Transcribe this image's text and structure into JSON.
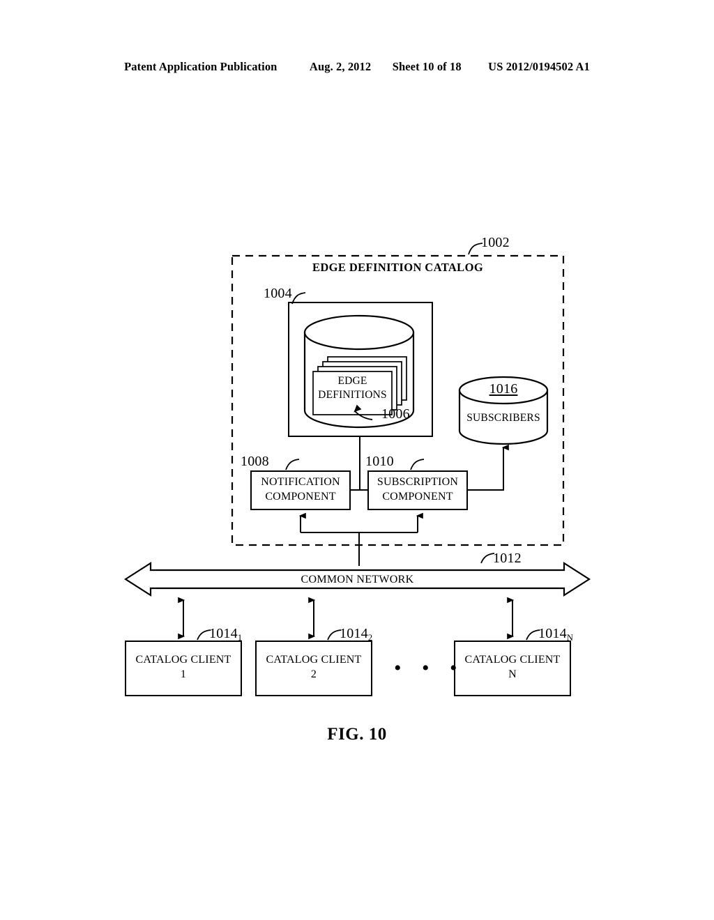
{
  "header": {
    "publication": "Patent Application Publication",
    "date": "Aug. 2, 2012",
    "sheet": "Sheet 10 of 18",
    "pub_number": "US 2012/0194502 A1"
  },
  "figure": {
    "caption": "FIG. 10",
    "catalog": {
      "title": "EDGE DEFINITION CATALOG",
      "ref": "1002"
    },
    "store_container": {
      "ref": "1004"
    },
    "edge_definitions": {
      "line1": "EDGE",
      "line2": "DEFINITIONS",
      "ref": "1006"
    },
    "subscribers": {
      "label": "SUBSCRIBERS",
      "ref": "1016"
    },
    "notification_component": {
      "line1": "NOTIFICATION",
      "line2": "COMPONENT",
      "ref": "1008"
    },
    "subscription_component": {
      "line1": "SUBSCRIPTION",
      "line2": "COMPONENT",
      "ref": "1010"
    },
    "network": {
      "label": "COMMON NETWORK",
      "ref": "1012"
    },
    "ellipsis": "• • •",
    "clients": [
      {
        "line1": "CATALOG CLIENT",
        "line2": "1",
        "ref_base": "1014",
        "ref_sub": "1"
      },
      {
        "line1": "CATALOG CLIENT",
        "line2": "2",
        "ref_base": "1014",
        "ref_sub": "2"
      },
      {
        "line1": "CATALOG CLIENT",
        "line2": "N",
        "ref_base": "1014",
        "ref_sub": "N"
      }
    ]
  },
  "colors": {
    "ink": "#000000",
    "paper": "#ffffff"
  }
}
